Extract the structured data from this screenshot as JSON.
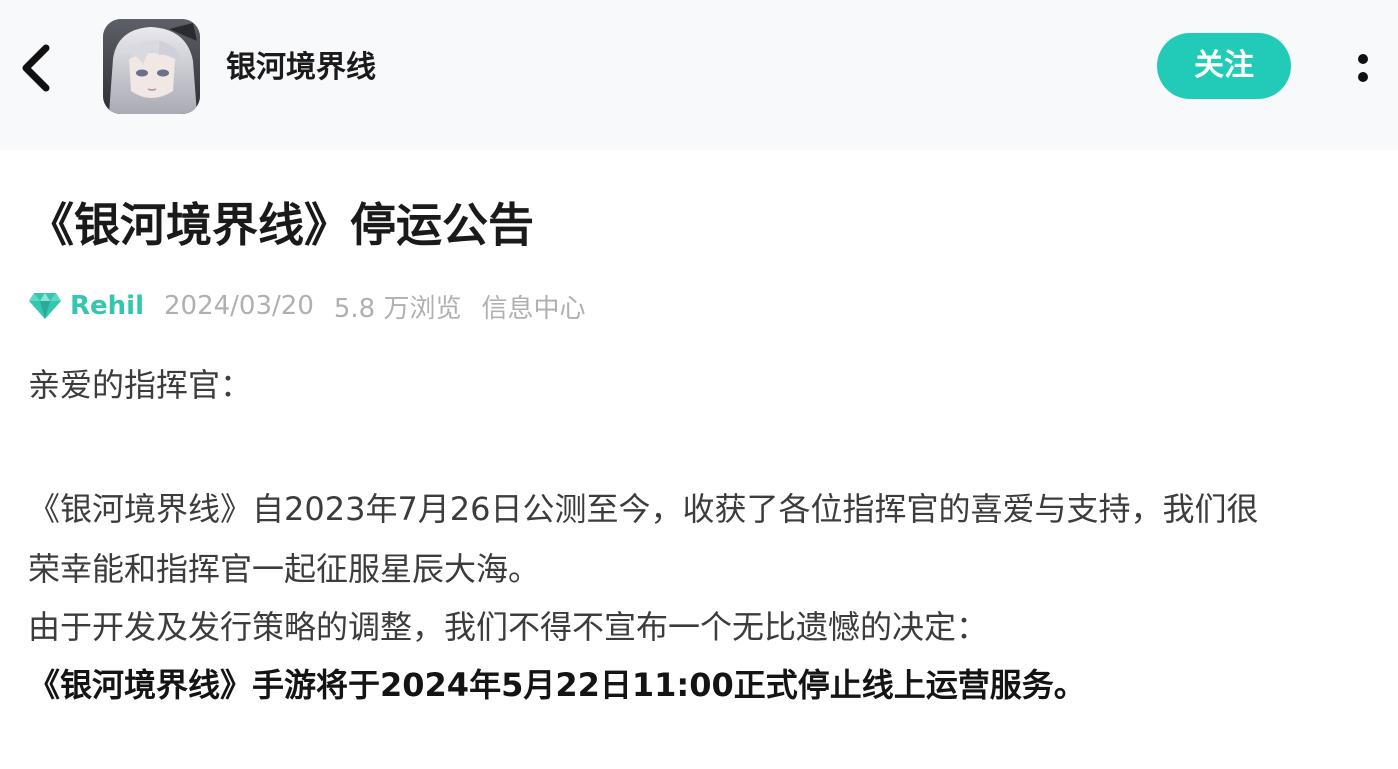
{
  "header": {
    "channel_name": "银河境界线",
    "follow_label": "关注",
    "back_icon": "chevron-left-icon",
    "more_icon": "more-vertical-icon",
    "avatar_desc": "game-avatar"
  },
  "article": {
    "title": "《银河境界线》停运公告",
    "author": "Rehil",
    "author_badge_icon": "gem-icon",
    "date": "2024/03/20",
    "views": "5.8 万浏览",
    "category": "信息中心",
    "greeting": "亲爱的指挥官：",
    "paragraph1_line1": "《银河境界线》自2023年7月26日公测至今，收获了各位指挥官的喜爱与支持，我们很",
    "paragraph1_line2": "荣幸能和指挥官一起征服星辰大海。",
    "paragraph2": "由于开发及发行策略的调整，我们不得不宣布一个无比遗憾的决定：",
    "announcement": "《银河境界线》手游将于2024年5月22日11:00正式停止线上运营服务。"
  },
  "colors": {
    "accent": "#21cbb7",
    "author_color": "#34c6ae",
    "header_bg": "#f8f9fb"
  }
}
